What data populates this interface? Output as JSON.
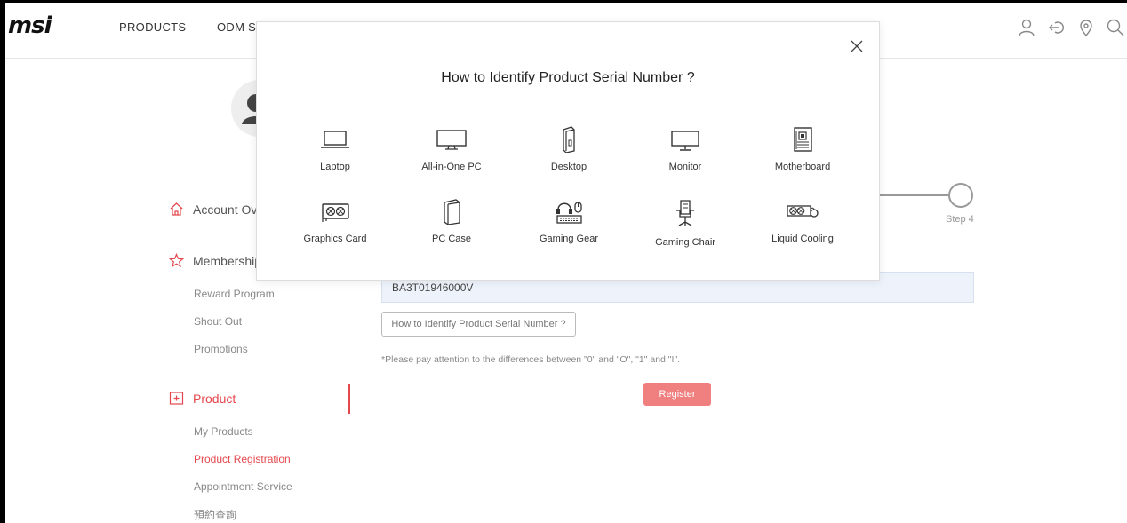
{
  "header": {
    "logo": "msi",
    "nav": [
      "PRODUCTS",
      "ODM SC"
    ]
  },
  "sidebar": {
    "groups": [
      {
        "label": "Account Ove",
        "icon": "home-icon"
      },
      {
        "label": "Membership",
        "icon": "star-icon"
      },
      {
        "label": "Product",
        "icon": "product-icon"
      }
    ],
    "membership_items": [
      "Reward Program",
      "Shout Out",
      "Promotions"
    ],
    "product_items": [
      "My Products",
      "Product Registration",
      "Appointment Service",
      "預約查詢"
    ],
    "active_item": "Product Registration"
  },
  "main": {
    "step_label": "Step 4",
    "serial_value": "BA3T01946000V",
    "identify_button": "How to Identify Product Serial Number ?",
    "note": "*Please pay attention to the differences between \"0\" and \"O\", \"1\" and \"I\".",
    "register_button": "Register"
  },
  "modal": {
    "title": "How to Identify Product Serial Number ?",
    "items": [
      {
        "label": "Laptop",
        "icon": "laptop-icon"
      },
      {
        "label": "All-in-One PC",
        "icon": "all-in-one-pc-icon"
      },
      {
        "label": "Desktop",
        "icon": "desktop-icon"
      },
      {
        "label": "Monitor",
        "icon": "monitor-icon"
      },
      {
        "label": "Motherboard",
        "icon": "motherboard-icon"
      },
      {
        "label": "Graphics Card",
        "icon": "graphics-card-icon"
      },
      {
        "label": "PC Case",
        "icon": "pc-case-icon"
      },
      {
        "label": "Gaming Gear",
        "icon": "gaming-gear-icon"
      },
      {
        "label": "Gaming Chair",
        "icon": "gaming-chair-icon"
      },
      {
        "label": "Liquid Cooling",
        "icon": "liquid-cooling-icon"
      }
    ]
  },
  "colors": {
    "accent": "#e4484d",
    "register": "#f07f7f",
    "serial_bg": "#eef3fb"
  }
}
